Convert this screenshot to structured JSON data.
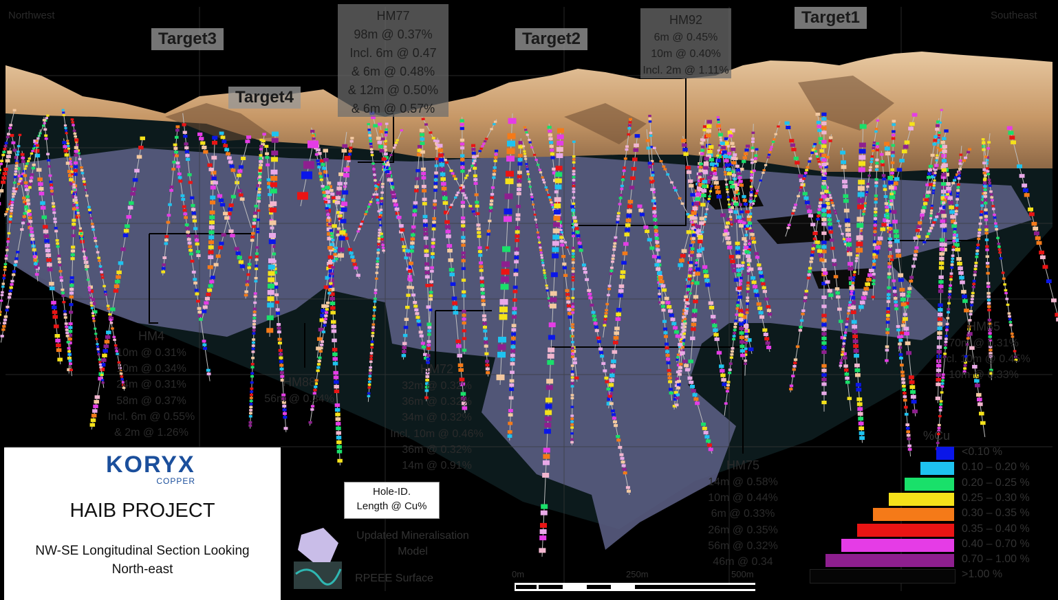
{
  "directions": {
    "left": "Northwest",
    "right": "Southeast"
  },
  "targets": [
    "Target3",
    "Target2",
    "Target1",
    "Target4"
  ],
  "callouts": {
    "hm77": {
      "id": "HM77",
      "lines": [
        "98m @ 0.37%",
        "Incl. 6m @ 0.47",
        "& 6m @ 0.48%",
        "& 12m @ 0.50%",
        "& 6m @ 0.57%"
      ]
    },
    "hm92": {
      "id": "HM92",
      "lines": [
        "6m @ 0.45%",
        "10m @ 0.40%",
        "Incl. 2m @ 1.11%"
      ]
    }
  },
  "holes": {
    "hm_left": {
      "id": "HM4",
      "lines": [
        "10m @ 0.31%",
        "10m @ 0.34%",
        "24m @ 0.31%",
        "58m @ 0.37%",
        "Incl. 6m @ 0.55%",
        "& 2m @ 1.26%"
      ]
    },
    "hm88": {
      "id": "HM88",
      "lines": [
        "56m @ 0.34%"
      ]
    },
    "hm72": {
      "id": "HM72",
      "lines": [
        "32m @ 0.32%",
        "36m @ 0.32%",
        "34m @ 0.32%",
        "Incl. 10m @ 0.46%",
        "36m @ 0.32%",
        "14m @ 0.91%"
      ]
    },
    "hm75": {
      "id": "HM75",
      "lines": [
        "14m @ 0.58%",
        "10m @ 0.44%",
        "6m @ 0.33%",
        "26m @ 0.35%",
        "56m @ 0.32%",
        "46m @ 0.34"
      ]
    },
    "hm85": {
      "id": "HM85",
      "lines": [
        "70m @ 0.31%",
        "Incl. 10m @ 0.45%",
        "10m @ 0.33%"
      ]
    }
  },
  "title_box": {
    "logo_text": "KORYX",
    "logo_sub": "COPPER",
    "project": "HAIB PROJECT",
    "subtitle_1": "NW-SE Longitudinal Section Looking",
    "subtitle_2": "North-east"
  },
  "key": {
    "line1": "Hole-ID.",
    "line2": "Length @ Cu%"
  },
  "legend": {
    "mineral_model": [
      "Updated Mineralisation",
      "Model"
    ],
    "rpeee": "RPEEE Surface"
  },
  "cu_legend": {
    "title": "%Cu",
    "classes": [
      {
        "label": "<0.10 %",
        "color": "#0a16e8"
      },
      {
        "label": "0.10 – 0.20 %",
        "color": "#1ec3f0"
      },
      {
        "label": "0.20 – 0.25 %",
        "color": "#19e06a"
      },
      {
        "label": "0.25 – 0.30 %",
        "color": "#f5e21a"
      },
      {
        "label": "0.30 – 0.35 %",
        "color": "#f57a18"
      },
      {
        "label": "0.35 – 0.40 %",
        "color": "#ea1414"
      },
      {
        "label": "0.40 – 0.70 %",
        "color": "#e53ce6"
      },
      {
        "label": "0.70 – 1.00 %",
        "color": "#8e1f8f"
      },
      {
        "label": ">1.00 %",
        "color": "#050505"
      }
    ]
  },
  "scale": {
    "labels": [
      "0m",
      "250m",
      "500m"
    ]
  }
}
